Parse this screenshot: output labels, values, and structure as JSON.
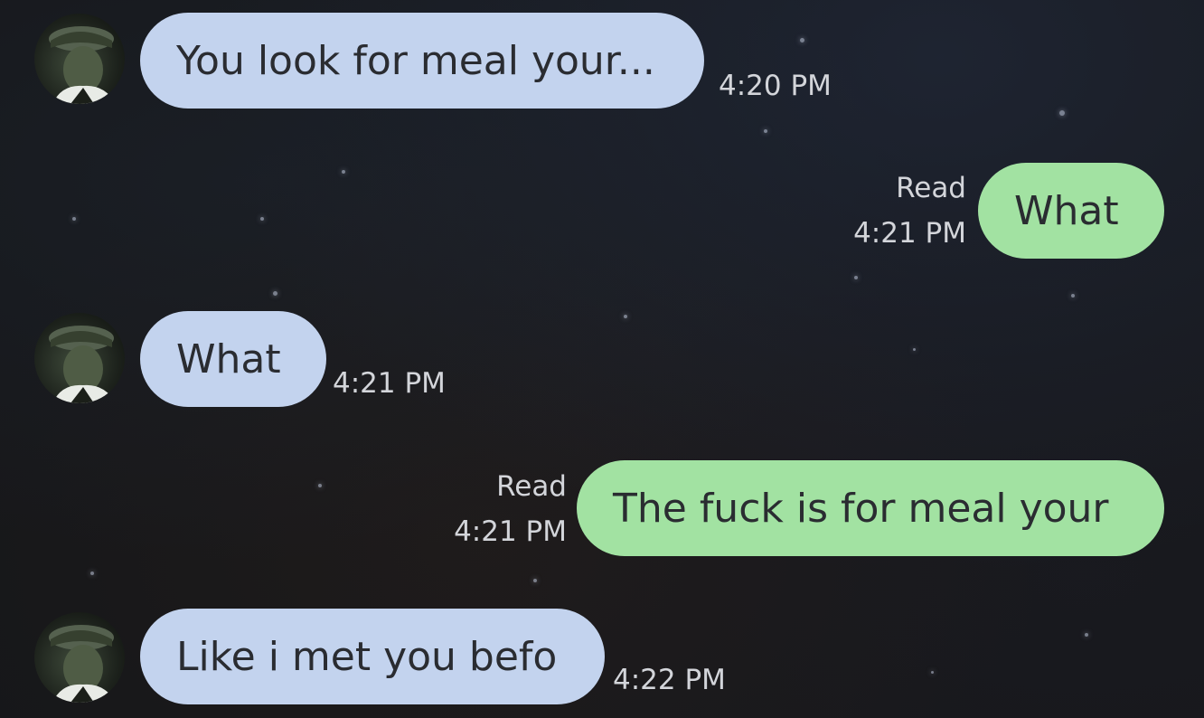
{
  "messages": [
    {
      "direction": "incoming",
      "text": "You look for meal your...",
      "time": "4:20 PM"
    },
    {
      "direction": "outgoing",
      "text": "What",
      "status": "Read",
      "time": "4:21 PM"
    },
    {
      "direction": "incoming",
      "text": "What",
      "time": "4:21 PM"
    },
    {
      "direction": "outgoing",
      "text": "The fuck is for meal your",
      "status": "Read",
      "time": "4:21 PM"
    },
    {
      "direction": "incoming",
      "text": "Like i met you befo",
      "time": "4:22 PM"
    }
  ],
  "colors": {
    "incoming_bubble": "#c3d3ee",
    "outgoing_bubble": "#a2e2a2",
    "background": "#16171a",
    "meta_text": "#d3d5da"
  },
  "icons": {
    "contact_avatar": "person-with-cap-avatar"
  }
}
